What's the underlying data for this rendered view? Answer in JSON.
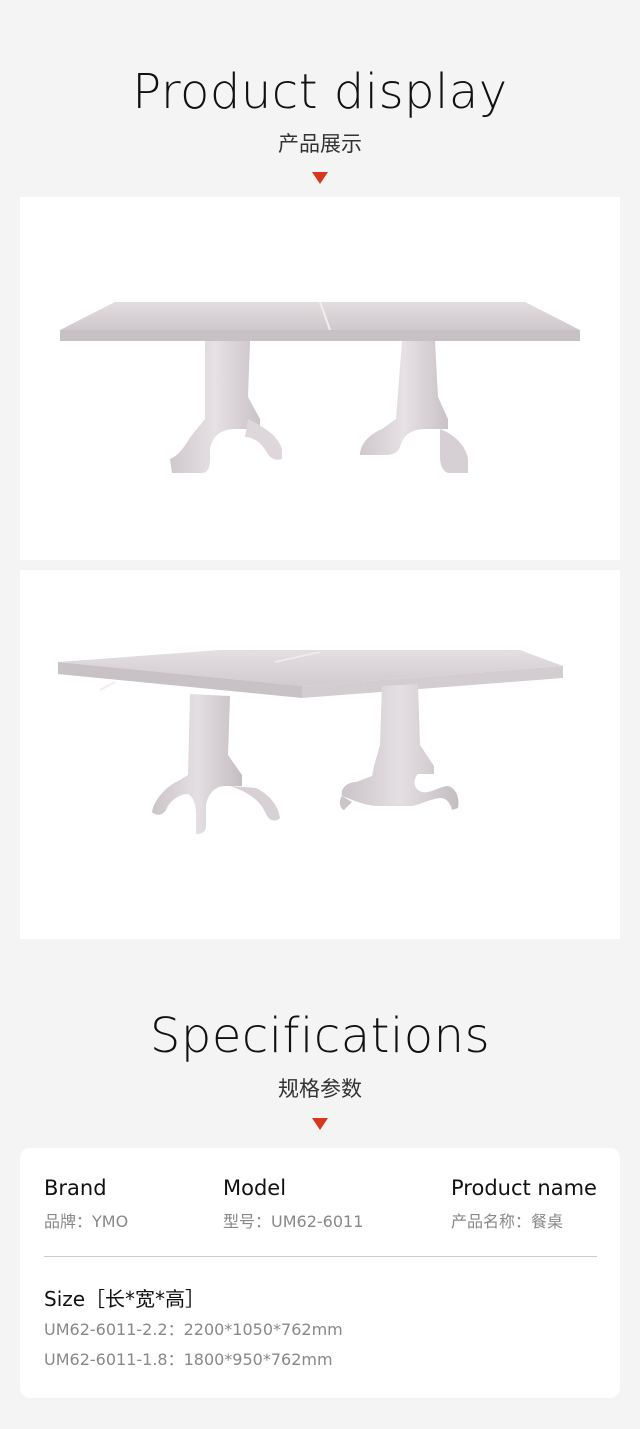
{
  "product_display": {
    "title": "Product display",
    "subtitle": "产品展示"
  },
  "specifications": {
    "title": "Specifications",
    "subtitle": "规格参数",
    "brand": {
      "label": "Brand",
      "value": "品牌：YMO"
    },
    "model": {
      "label": "Model",
      "value": "型号：UM62-6011"
    },
    "product_name": {
      "label": "Product name",
      "value": "产品名称：餐桌"
    },
    "size": {
      "label": "Size［长*宽*高］",
      "values": [
        "UM62-6011-2.2：2200*1050*762mm",
        "UM62-6011-1.8：1800*950*762mm"
      ]
    }
  },
  "colors": {
    "accent": "#d9361e",
    "background": "#f4f4f4",
    "table_finish": "#dcd6da"
  }
}
